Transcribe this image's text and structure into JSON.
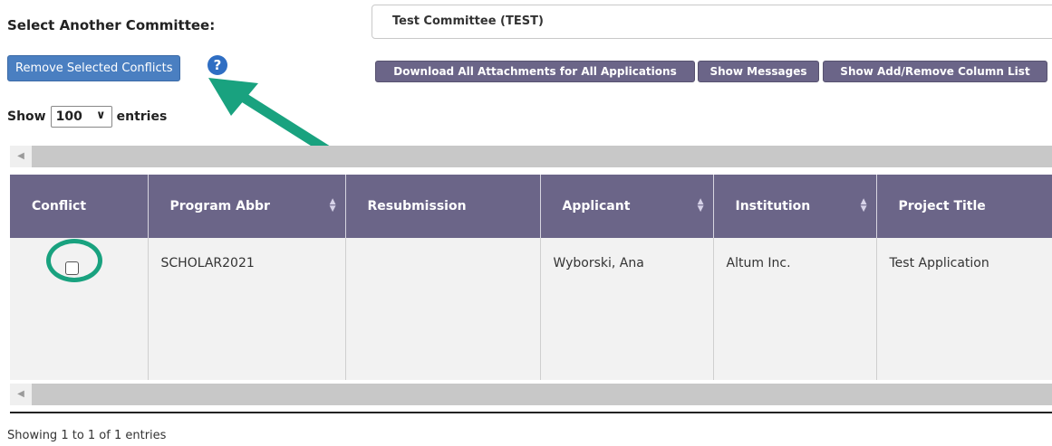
{
  "committee": {
    "label": "Select Another Committee:",
    "selected": "Test Committee (TEST)"
  },
  "toolbar": {
    "remove_label": "Remove Selected Conflicts",
    "help_symbol": "?",
    "download_label": "Download All Attachments for All Applications",
    "messages_label": "Show Messages",
    "columns_label": "Show Add/Remove Column List"
  },
  "entries": {
    "show_label": "Show",
    "value": "100",
    "suffix": "entries"
  },
  "table": {
    "columns": [
      "Conflict",
      "Program Abbr",
      "Resubmission",
      "Applicant",
      "Institution",
      "Project Title"
    ],
    "rows": [
      {
        "conflict_checked": false,
        "program_abbr": "SCHOLAR2021",
        "resubmission": "",
        "applicant": "Wyborski, Ana",
        "institution": "Altum Inc.",
        "project_title": "Test Application"
      }
    ]
  },
  "footer": {
    "info": "Showing 1 to 1 of 1 entries"
  },
  "colors": {
    "header_purple": "#6b6588",
    "primary_blue": "#4a7fc1",
    "annotation_green": "#19a27f"
  },
  "icons": {
    "help": "question-circle-icon",
    "chevron": "chevron-down-icon",
    "sort": "sort-icon",
    "scroll_left": "scroll-left-arrow-icon"
  }
}
